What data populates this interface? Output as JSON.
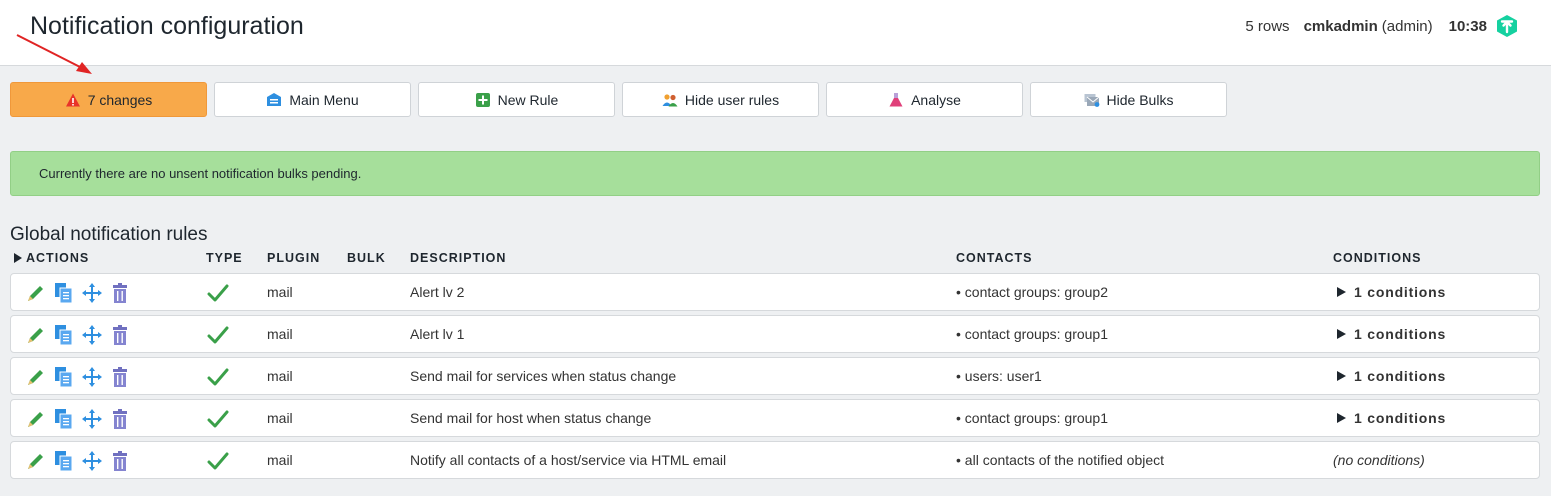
{
  "header": {
    "title": "Notification configuration",
    "rows": "5 rows",
    "username": "cmkadmin",
    "role": "(admin)",
    "time": "10:38"
  },
  "toolbar": {
    "changes": "7 changes",
    "main_menu": "Main Menu",
    "new_rule": "New Rule",
    "hide_user_rules": "Hide user rules",
    "analyse": "Analyse",
    "hide_bulks": "Hide Bulks"
  },
  "message": "Currently there are no unsent notification bulks pending.",
  "section_title": "Global notification rules",
  "columns": {
    "actions": "ACTIONS",
    "type": "TYPE",
    "plugin": "PLUGIN",
    "bulk": "BULK",
    "description": "DESCRIPTION",
    "contacts": "CONTACTS",
    "conditions": "CONDITIONS"
  },
  "rules": [
    {
      "plugin": "mail",
      "description": "Alert lv 2",
      "contacts": "• contact groups: group2",
      "conditions": "1 conditions"
    },
    {
      "plugin": "mail",
      "description": "Alert lv 1",
      "contacts": "• contact groups: group1",
      "conditions": "1 conditions"
    },
    {
      "plugin": "mail",
      "description": "Send mail for services when status change",
      "contacts": "• users: user1",
      "conditions": "1 conditions"
    },
    {
      "plugin": "mail",
      "description": "Send mail for host when status change",
      "contacts": "• contact groups: group1",
      "conditions": "1 conditions"
    },
    {
      "plugin": "mail",
      "description": "Notify all contacts of a host/service via HTML email",
      "contacts": "• all contacts of the notified object",
      "no_conditions": "(no conditions)"
    }
  ],
  "colors": {
    "changes_button": "#f8a94a",
    "success_message": "#a6df9b",
    "check": "#3aa049",
    "brand": "#15d1a0"
  }
}
